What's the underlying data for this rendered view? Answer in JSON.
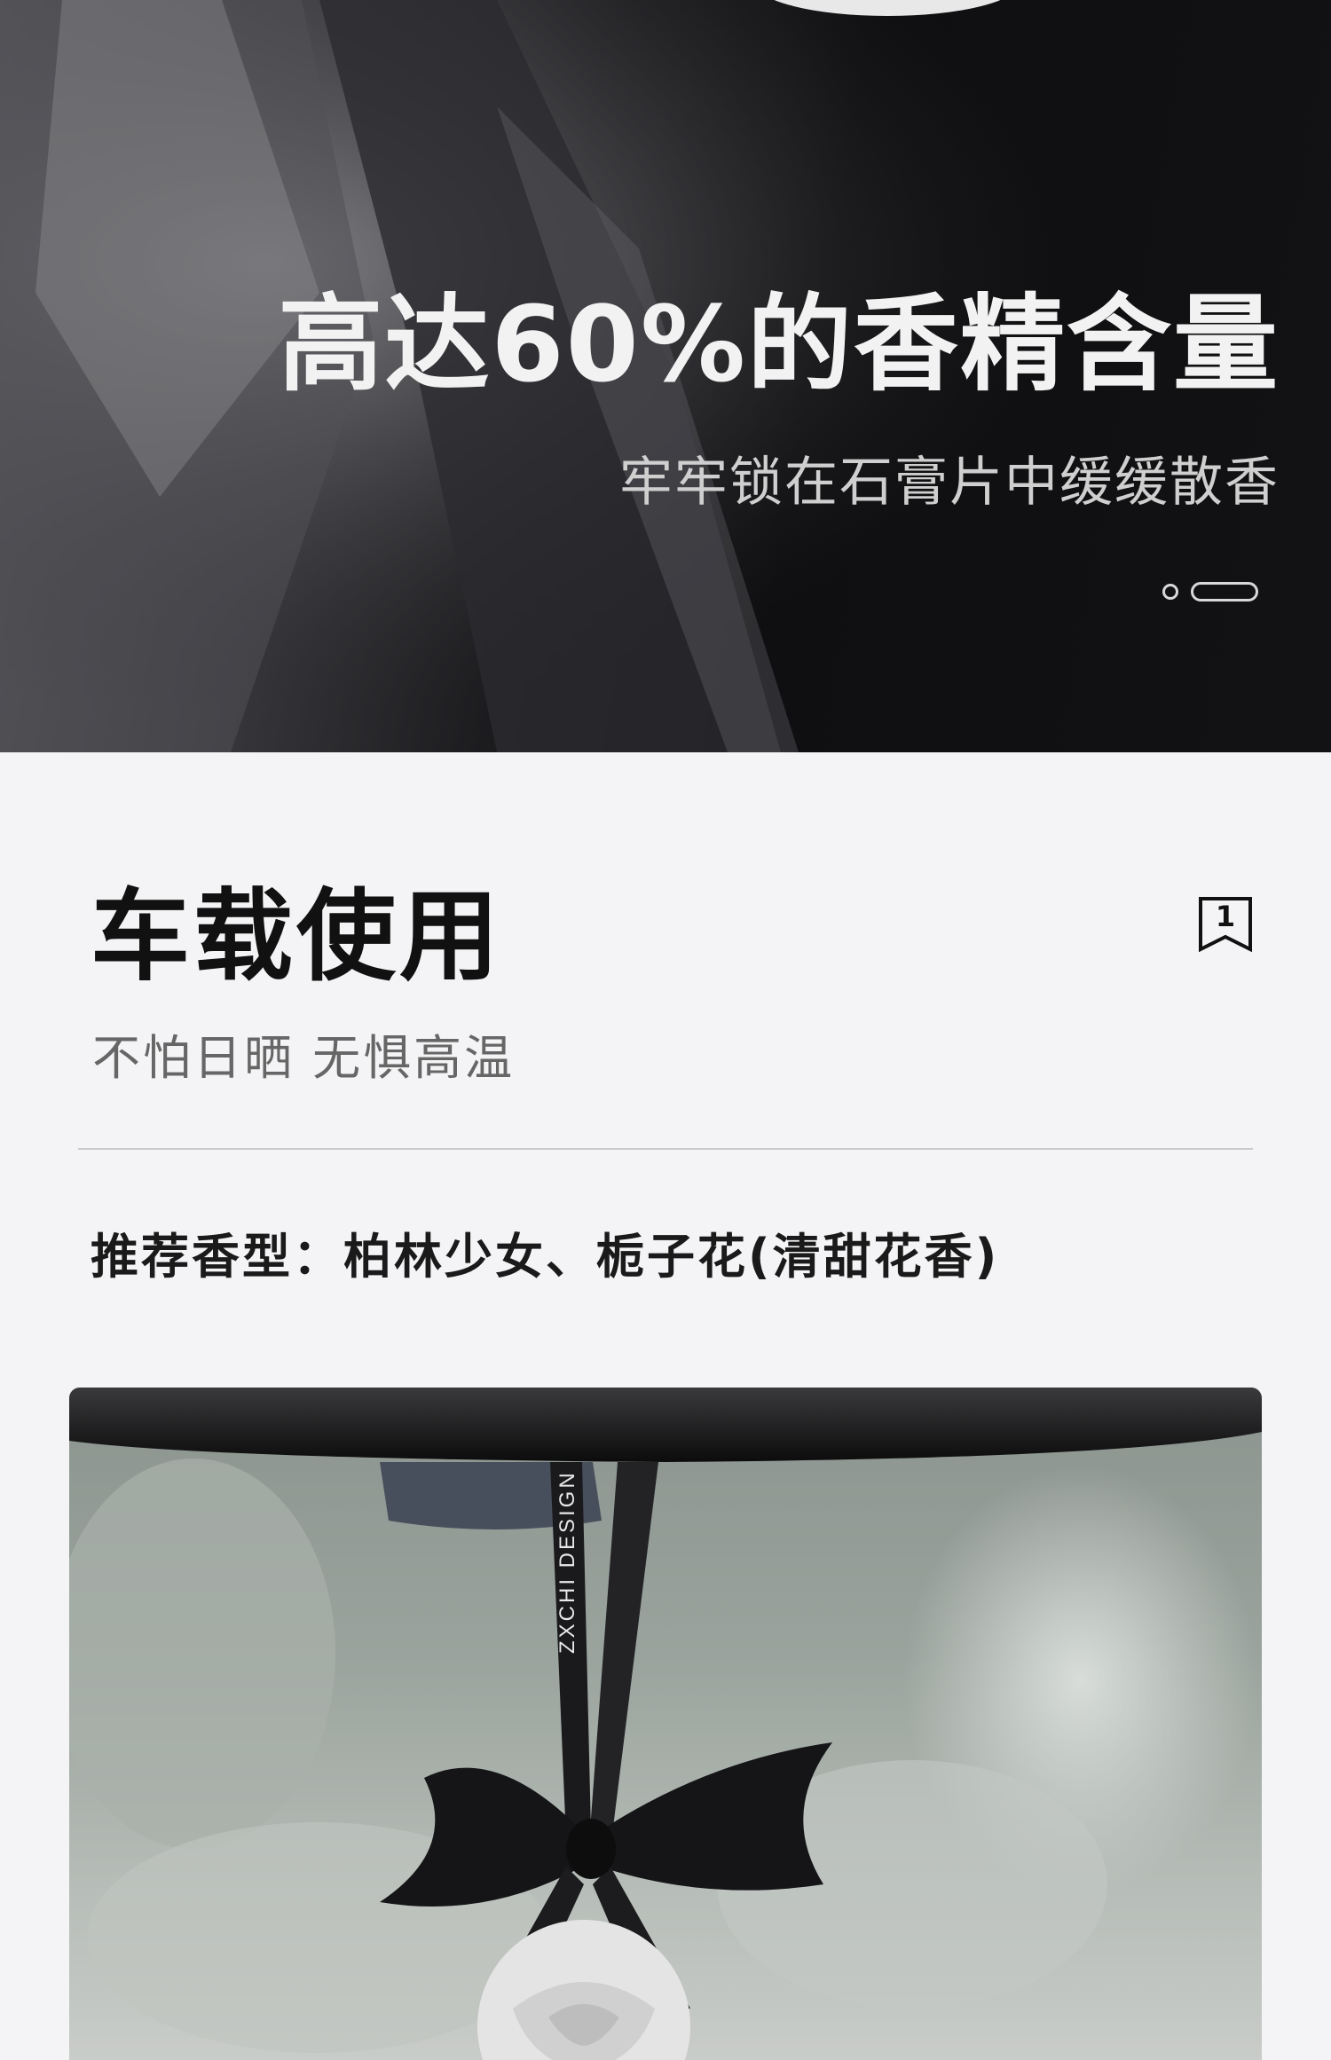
{
  "hero": {
    "title": "高达60%的香精含量",
    "subtitle": "牢牢锁在石膏片中缓缓散香",
    "carousel": {
      "count": 2,
      "active_index": 1
    }
  },
  "section": {
    "title": "车载使用",
    "subtitle": "不怕日晒 无惧高温",
    "badge_number": "1",
    "recommend": "推荐香型：柏林少女、栀子花(清甜花香)"
  },
  "photo": {
    "ribbon_text": "ZXCHI DESIGN"
  },
  "colors": {
    "page_bg": "#f4f4f6",
    "hero_dark": "#0f0f11",
    "title_text": "#111111",
    "subtitle_text": "#666666"
  }
}
